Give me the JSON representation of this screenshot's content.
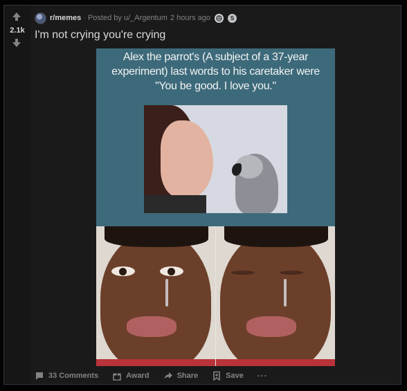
{
  "post": {
    "score": "2.1k",
    "subreddit": "r/memes",
    "posted_by": "Posted by u/_Argentum",
    "time_ago": "2 hours ago",
    "separator": "·",
    "title": "I'm not crying you're crying",
    "award_icons": [
      "wholesome-award-icon",
      "silver-award-icon"
    ],
    "award_glyph": "S"
  },
  "image": {
    "caption_line1": "Alex the parrot's (A subject of a 37-year",
    "caption_line2": "experiment) last words to his caretaker were",
    "caption_line3": "\"You be good. I love you.\""
  },
  "actions": {
    "comments": "33 Comments",
    "award": "Award",
    "share": "Share",
    "save": "Save",
    "more": "···"
  },
  "colors": {
    "background": "#030303",
    "card": "#1a1a1b",
    "text": "#d7dadc",
    "muted": "#818384",
    "meme_panel": "#3d6a7a"
  }
}
